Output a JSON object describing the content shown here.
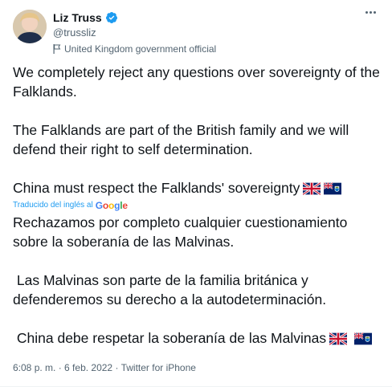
{
  "author": {
    "name": "Liz Truss",
    "handle": "@trussliz",
    "label": "United Kingdom government official"
  },
  "tweet": {
    "paragraphs": [
      "We completely reject any questions over sovereignty of the Falklands.",
      "The Falklands are part of the British family and we will defend their right to self determination.",
      "China must respect the Falklands' sovereignty"
    ],
    "translated_by": "Traducido del inglés al",
    "translator_brand": "Google",
    "translation": [
      "Rechazamos por completo cualquier cuestionamiento sobre la soberanía de las Malvinas.",
      " Las Malvinas son parte de la familia británica y defenderemos su derecho a la autodeterminación.",
      " China debe respetar la soberanía de las Malvinas"
    ]
  },
  "meta": {
    "time": "6:08 p. m.",
    "separator1": " · ",
    "date": "6 feb. 2022",
    "separator2": " · ",
    "source": "Twitter for iPhone"
  },
  "icons": {
    "verified": "verified-badge-icon",
    "flag": "government-flag-icon",
    "more": "more-options-icon",
    "uk": "uk-flag-emoji",
    "falklands": "falkland-islands-flag-emoji"
  },
  "colors": {
    "link": "#1d9bf0",
    "secondary": "#536471",
    "verified": "#1d9bf0"
  }
}
